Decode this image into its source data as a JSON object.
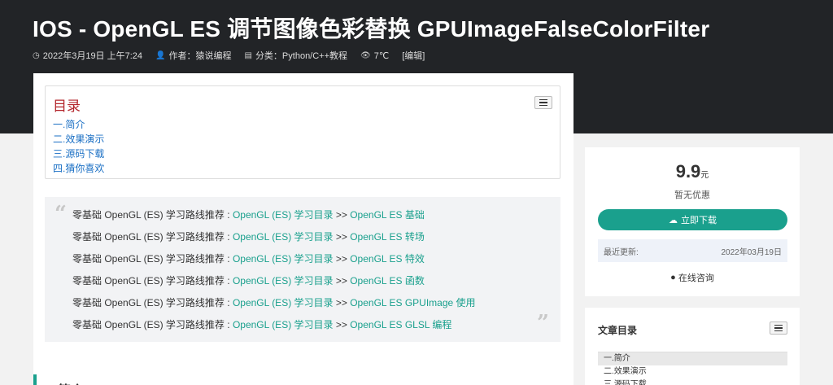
{
  "header": {
    "title": "IOS  -  OpenGL ES 调节图像色彩替换 GPUImageFalseColorFilter",
    "meta": {
      "date": "2022年3月19日 上午7:24",
      "author": "作者：猿说编程",
      "category": "分类：Python/C++教程",
      "views": "7℃",
      "edit": "[编辑]"
    }
  },
  "toc": {
    "title": "目录",
    "items": [
      "一.简介",
      "二.效果演示",
      "三.源码下载",
      "四.猜你喜欢"
    ]
  },
  "quote": {
    "prefix": "零基础 OpenGL (ES) 学习路线推荐 : ",
    "link1": "OpenGL (ES) 学习目录",
    "sep": " >> ",
    "lines": [
      "OpenGL ES 基础",
      "OpenGL ES 转场",
      "OpenGL ES 特效",
      "OpenGL ES 函数",
      "OpenGL ES GPUImage 使用",
      "OpenGL ES GLSL 编程"
    ]
  },
  "section": {
    "heading": "简介"
  },
  "buybox": {
    "price": "9.9",
    "unit": "元",
    "discount": "暂无优惠",
    "download_label": "立即下载",
    "updated_label": "最近更新:",
    "updated_value": "2022年03月19日",
    "consult_label": "在线咨询"
  },
  "sidetoc": {
    "title": "文章目录",
    "items": [
      "一.简介",
      "二.效果演示",
      "三.源码下载"
    ]
  },
  "colors": {
    "accent": "#1aa08d",
    "hero": "#222427",
    "toc_title": "#b3252b",
    "toc_link": "#1a6fc4"
  }
}
